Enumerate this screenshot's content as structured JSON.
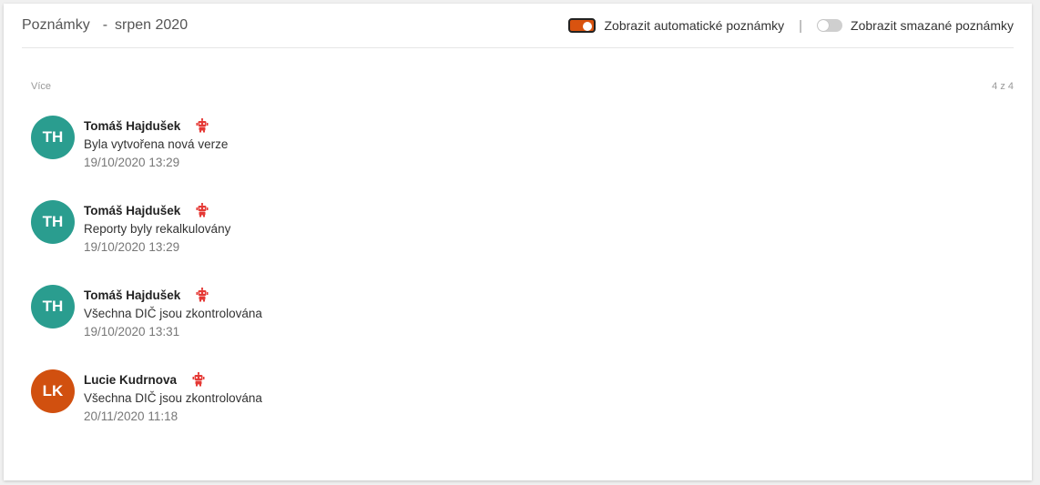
{
  "header": {
    "title": "Poznámky",
    "dash": "-",
    "period": "srpen 2020",
    "toggle_auto_label": "Zobrazit automatické poznámky",
    "toggle_auto_on": true,
    "separator": "|",
    "toggle_deleted_label": "Zobrazit smazané poznámky",
    "toggle_deleted_on": false
  },
  "list": {
    "more_label": "Více",
    "count_label": "4 z 4"
  },
  "colors": {
    "accent": "#d9530f",
    "avatar_teal": "#2a9d8f",
    "avatar_orange": "#d1500f",
    "bot_icon": "#e53935"
  },
  "notes": [
    {
      "initials": "TH",
      "author": "Tomáš Hajdušek",
      "text": "Byla vytvořena nová verze",
      "time": "19/10/2020 13:29",
      "icon": "robot-icon"
    },
    {
      "initials": "TH",
      "author": "Tomáš Hajdušek",
      "text": "Reporty byly rekalkulovány",
      "time": "19/10/2020 13:29",
      "icon": "robot-icon"
    },
    {
      "initials": "TH",
      "author": "Tomáš Hajdušek",
      "text": "Všechna DIČ jsou zkontrolována",
      "time": "19/10/2020 13:31",
      "icon": "robot-icon"
    },
    {
      "initials": "LK",
      "author": "Lucie Kudrnova",
      "text": "Všechna DIČ jsou zkontrolována",
      "time": "20/11/2020 11:18",
      "icon": "robot-icon"
    }
  ]
}
